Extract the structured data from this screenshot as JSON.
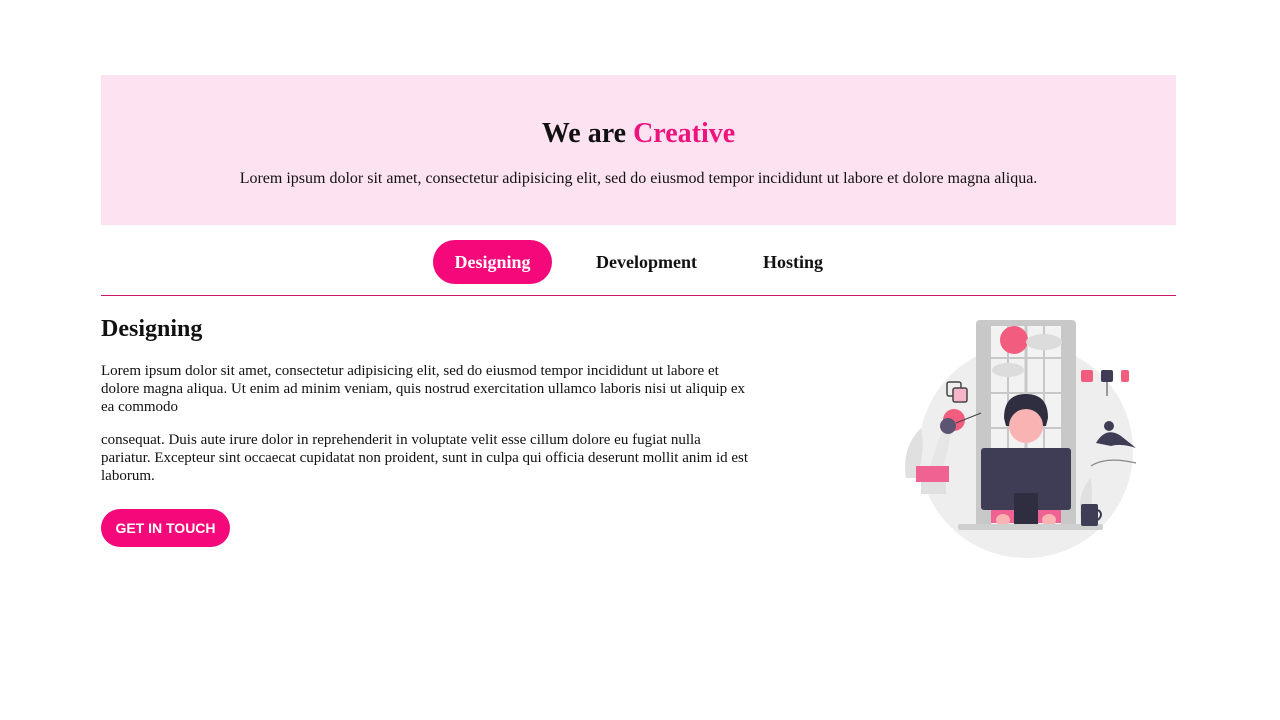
{
  "hero": {
    "title_prefix": "We are ",
    "title_accent": "Creative",
    "subtitle": "Lorem ipsum dolor sit amet, consectetur adipisicing elit, sed do eiusmod tempor incididunt ut labore et dolore magna aliqua."
  },
  "tabs": [
    {
      "label": "Designing",
      "active": true
    },
    {
      "label": "Development",
      "active": false
    },
    {
      "label": "Hosting",
      "active": false
    }
  ],
  "panel": {
    "heading": "Designing",
    "paragraph1": "Lorem ipsum dolor sit amet, consectetur adipisicing elit, sed do eiusmod tempor incididunt ut labore et dolore magna aliqua. Ut enim ad minim veniam, quis nostrud exercitation ullamco laboris nisi ut aliquip ex ea commodo",
    "paragraph2": "consequat. Duis aute irure dolor in reprehenderit in voluptate velit esse cillum dolore eu fugiat nulla pariatur. Excepteur sint occaecat cupidatat non proident, sunt in culpa qui officia deserunt mollit anim id est laborum.",
    "cta_label": "GET IN TOUCH",
    "illustration_icon": "person-at-computer-illustration"
  },
  "colors": {
    "accent": "#f5087a",
    "hero_bg": "#fde3f1",
    "divider": "#c8186f"
  }
}
